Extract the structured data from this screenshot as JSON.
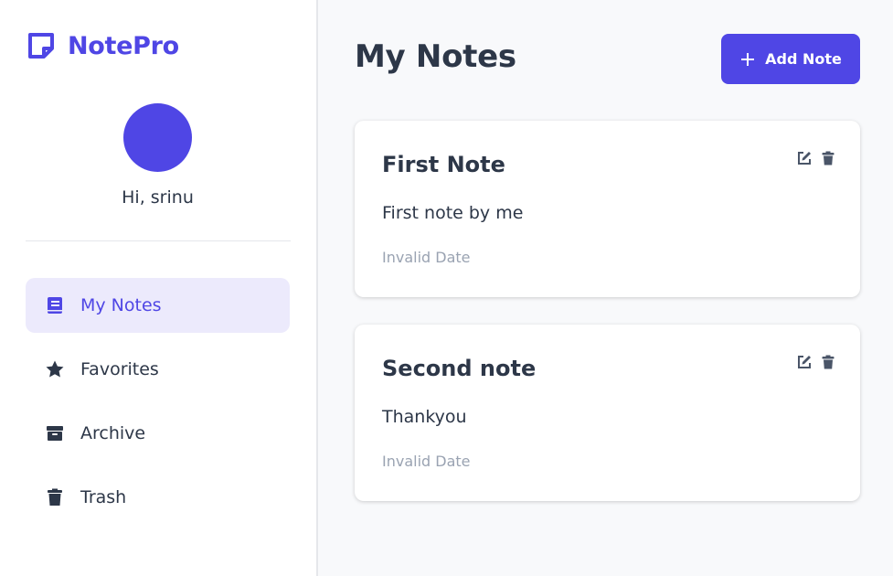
{
  "app": {
    "brand": "NotePro",
    "brand_color": "#4f46e5",
    "greeting": "Hi, srinu"
  },
  "sidebar": {
    "items": [
      {
        "label": "My Notes",
        "icon": "book-icon",
        "active": true
      },
      {
        "label": "Favorites",
        "icon": "star-icon",
        "active": false
      },
      {
        "label": "Archive",
        "icon": "archive-box-icon",
        "active": false
      },
      {
        "label": "Trash",
        "icon": "trash-icon",
        "active": false
      }
    ]
  },
  "main": {
    "title": "My Notes",
    "add_button_label": "Add Note",
    "notes": [
      {
        "title": "First Note",
        "body": "First note by me",
        "date": "Invalid Date"
      },
      {
        "title": "Second note",
        "body": "Thankyou",
        "date": "Invalid Date"
      }
    ]
  }
}
